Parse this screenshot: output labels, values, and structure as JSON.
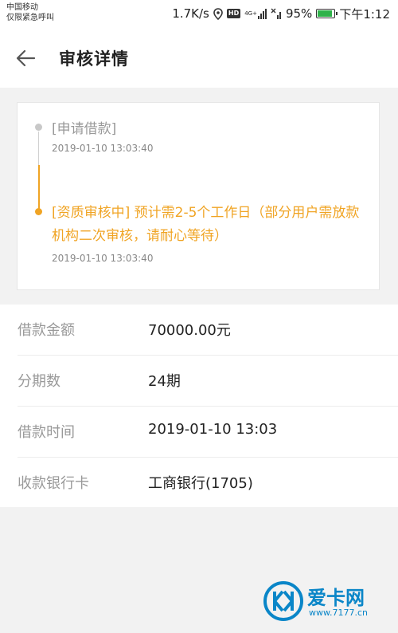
{
  "status_bar": {
    "carrier_line1": "中国移动",
    "carrier_line2": "仅限紧急呼叫",
    "network_speed": "1.7K/s",
    "hd_badge": "HD",
    "network_type": "4G+",
    "battery_percent": "95%",
    "battery_level": 0.95,
    "time": "下午1:12"
  },
  "header": {
    "title": "审核详情",
    "back_icon": "arrow-left-icon"
  },
  "timeline": {
    "steps": [
      {
        "title": "[申请借款]",
        "time": "2019-01-10 13:03:40",
        "status": "done",
        "color": "#999999"
      },
      {
        "title": "[资质审核中] 预计需2-5个工作日（部分用户需放款机构二次审核，请耐心等待）",
        "time": "2019-01-10 13:03:40",
        "status": "current",
        "color": "#f0a424"
      }
    ]
  },
  "details": [
    {
      "label": "借款金额",
      "value": "70000.00元"
    },
    {
      "label": "分期数",
      "value": "24期"
    },
    {
      "label": "借款时间",
      "value": "2019-01-10 13:03"
    },
    {
      "label": "收款银行卡",
      "value": "工商银行(1705)"
    }
  ],
  "watermark": {
    "brand": "爱卡网",
    "url": "www.7177.cn"
  },
  "colors": {
    "accent": "#f0a424",
    "watermark": "#0a86c8",
    "battery": "#2fb24a"
  }
}
